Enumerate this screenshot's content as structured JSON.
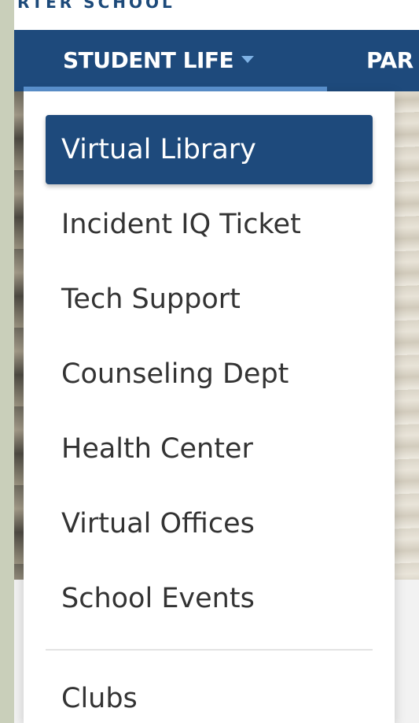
{
  "header": {
    "school_name_fragment": "RTER SCHOOL"
  },
  "nav": {
    "items": [
      {
        "label": "STUDENT LIFE",
        "active": true,
        "has_dropdown": true
      },
      {
        "label": "PAR",
        "active": false
      }
    ]
  },
  "dropdown": {
    "items": [
      {
        "label": "Virtual Library",
        "active": true
      },
      {
        "label": "Incident IQ Ticket",
        "active": false
      },
      {
        "label": "Tech Support",
        "active": false
      },
      {
        "label": "Counseling Dept",
        "active": false
      },
      {
        "label": "Health Center",
        "active": false
      },
      {
        "label": "Virtual Offices",
        "active": false
      },
      {
        "label": "School Events",
        "active": false
      },
      {
        "label": "Clubs",
        "active": false
      }
    ]
  },
  "colors": {
    "nav_background": "#1e4a7c",
    "active_item_background": "#1e4a7c",
    "active_indicator": "#5b92cf",
    "caret": "#7fb2e5",
    "menu_text": "#333333",
    "page_frame": "#c9cfba"
  },
  "icons": {
    "dropdown_caret": "caret-down-icon"
  }
}
